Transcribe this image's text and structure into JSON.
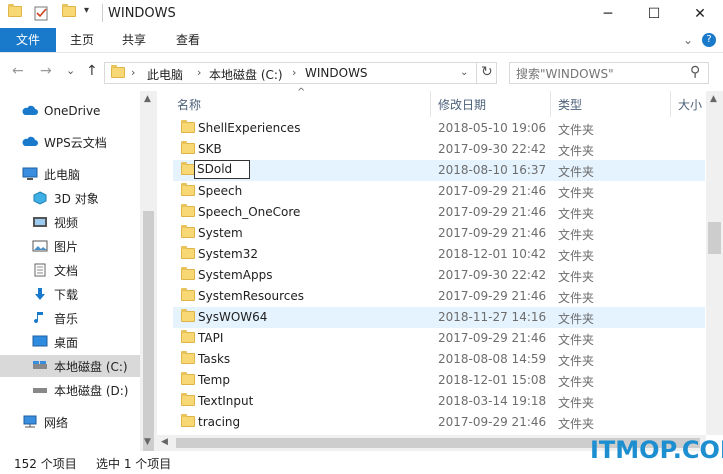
{
  "window": {
    "title": "WINDOWS",
    "minimize": "─",
    "maximize": "☐",
    "close": "✕"
  },
  "ribbon": {
    "tabs": [
      "文件",
      "主页",
      "共享",
      "查看"
    ],
    "expand": "⌄",
    "help": "?"
  },
  "nav": {
    "back": "←",
    "forward": "→",
    "history": "⌄",
    "up": "↑",
    "breadcrumbs": [
      "此电脑",
      "本地磁盘 (C:)",
      "WINDOWS"
    ],
    "refresh": "↻",
    "search_placeholder": "搜索\"WINDOWS\"",
    "search_icon": "⚲"
  },
  "sidebar": {
    "items": [
      {
        "label": "OneDrive",
        "icon": "cloud-icon",
        "color": "#1979ca"
      },
      {
        "label": "WPS云文档",
        "icon": "cloud-icon",
        "color": "#1979ca"
      },
      {
        "label": "此电脑",
        "icon": "computer-icon",
        "color": "#1979ca"
      },
      {
        "label": "3D 对象",
        "icon": "cube-icon",
        "color": "#2fa0d8"
      },
      {
        "label": "视频",
        "icon": "video-icon",
        "color": "#444"
      },
      {
        "label": "图片",
        "icon": "picture-icon",
        "color": "#444"
      },
      {
        "label": "文档",
        "icon": "document-icon",
        "color": "#444"
      },
      {
        "label": "下载",
        "icon": "download-icon",
        "color": "#1979ca"
      },
      {
        "label": "音乐",
        "icon": "music-icon",
        "color": "#1979ca"
      },
      {
        "label": "桌面",
        "icon": "desktop-icon",
        "color": "#1979ca"
      },
      {
        "label": "本地磁盘 (C:)",
        "icon": "drive-icon",
        "color": "#666"
      },
      {
        "label": "本地磁盘 (D:)",
        "icon": "drive-icon",
        "color": "#666"
      },
      {
        "label": "网络",
        "icon": "network-icon",
        "color": "#1979ca"
      }
    ]
  },
  "columns": {
    "name": "名称",
    "date": "修改日期",
    "type": "类型",
    "size": "大小"
  },
  "files": [
    {
      "name": "ShellExperiences",
      "date": "2018-05-10 19:06",
      "type": "文件夹"
    },
    {
      "name": "SKB",
      "date": "2017-09-30 22:42",
      "type": "文件夹"
    },
    {
      "name": "SDold",
      "date": "2018-08-10 16:37",
      "type": "文件夹"
    },
    {
      "name": "Speech",
      "date": "2017-09-29 21:46",
      "type": "文件夹"
    },
    {
      "name": "Speech_OneCore",
      "date": "2017-09-29 21:46",
      "type": "文件夹"
    },
    {
      "name": "System",
      "date": "2017-09-29 21:46",
      "type": "文件夹"
    },
    {
      "name": "System32",
      "date": "2018-12-01 10:42",
      "type": "文件夹"
    },
    {
      "name": "SystemApps",
      "date": "2017-09-30 22:42",
      "type": "文件夹"
    },
    {
      "name": "SystemResources",
      "date": "2017-09-29 21:46",
      "type": "文件夹"
    },
    {
      "name": "SysWOW64",
      "date": "2018-11-27 14:16",
      "type": "文件夹"
    },
    {
      "name": "TAPI",
      "date": "2017-09-29 21:46",
      "type": "文件夹"
    },
    {
      "name": "Tasks",
      "date": "2018-08-08 14:59",
      "type": "文件夹"
    },
    {
      "name": "Temp",
      "date": "2018-12-01 15:08",
      "type": "文件夹"
    },
    {
      "name": "TextInput",
      "date": "2018-03-14 19:18",
      "type": "文件夹"
    },
    {
      "name": "tracing",
      "date": "2017-09-29 21:46",
      "type": "文件夹"
    }
  ],
  "status": {
    "count": "152 个项目",
    "selected": "选中 1 个项目"
  },
  "watermark": "ITMOP.COM"
}
